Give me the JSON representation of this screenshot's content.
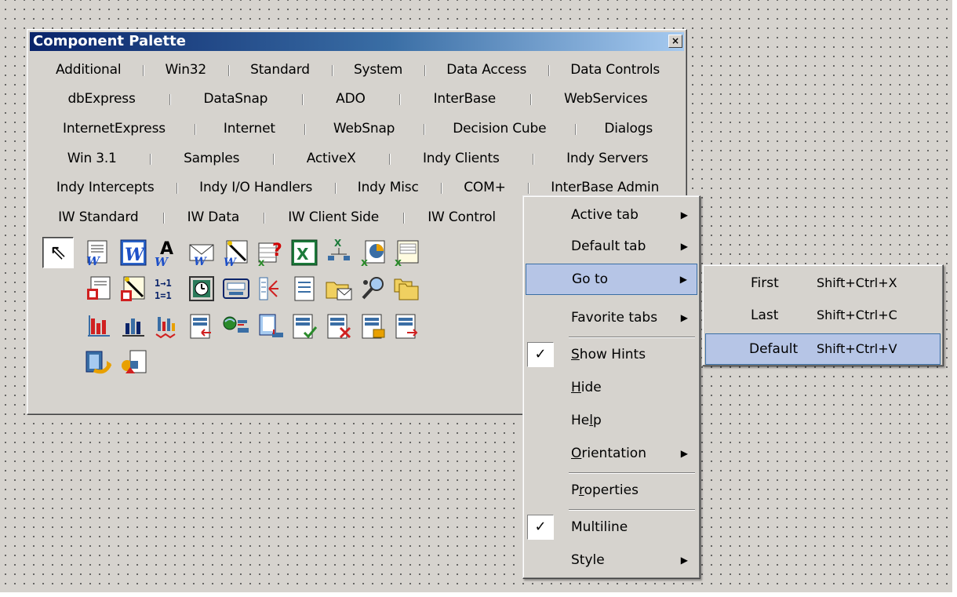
{
  "window": {
    "title": "Component Palette",
    "close_glyph": "×"
  },
  "tab_rows": [
    [
      "Additional",
      "Win32",
      "Standard",
      "System",
      "Data Access",
      "Data Controls"
    ],
    [
      "dbExpress",
      "DataSnap",
      "ADO",
      "InterBase",
      "WebServices"
    ],
    [
      "InternetExpress",
      "Internet",
      "WebSnap",
      "Decision Cube",
      "Dialogs"
    ],
    [
      "Win 3.1",
      "Samples",
      "ActiveX",
      "Indy Clients",
      "Indy Servers"
    ],
    [
      "Indy Intercepts",
      "Indy I/O Handlers",
      "Indy Misc",
      "COM+",
      "InterBase Admin"
    ],
    [
      "IW Standard",
      "IW Data",
      "IW Client Side",
      "IW Control"
    ]
  ],
  "active_tab": "Additional",
  "icons": [
    "arrow-pointer-icon",
    "word-document-icon",
    "word-application-icon",
    "word-font-icon",
    "word-mail-icon",
    "word-wizard-icon",
    "excel-query-icon",
    "excel-application-icon",
    "excel-tree-icon",
    "excel-chart-icon",
    "excel-sheet-icon",
    "report-red-icon",
    "report-wizard-icon",
    "binary-arrows-icon",
    "clock-panel-icon",
    "keyboard-icon",
    "split-arrows-icon",
    "text-page-icon",
    "mail-folder-icon",
    "search-binoculars-icon",
    "folder-stack-icon",
    "red-bar-chart-icon",
    "blue-bar-chart-icon",
    "multi-bar-chart-icon",
    "data-page-icon",
    "globe-link-icon",
    "notebook-icon",
    "page-check-icon",
    "page-delete-icon",
    "page-edit-icon",
    "page-insert-icon",
    "recycle-arrow-icon",
    "shapes-page-icon"
  ],
  "context_menu": {
    "items": [
      {
        "label": "Active tab",
        "submenu": true
      },
      {
        "label": "Default tab",
        "submenu": true
      },
      {
        "label": "Go to",
        "submenu": true,
        "highlighted": true
      },
      {
        "label": "Favorite tabs",
        "submenu": true
      },
      {
        "label": "Show Hints",
        "accel": "S",
        "checked": true
      },
      {
        "label": "Hide",
        "accel": "H"
      },
      {
        "label": "Help",
        "accel": "l"
      },
      {
        "label": "Orientation",
        "accel": "O",
        "submenu": true
      },
      {
        "label": "Properties",
        "accel": "r"
      },
      {
        "label": "Multiline",
        "checked": true
      },
      {
        "label": "Style",
        "submenu": true
      }
    ],
    "check_glyph": "✓",
    "arrow_glyph": "▶"
  },
  "goto_submenu": {
    "items": [
      {
        "label": "First",
        "shortcut": "Shift+Ctrl+X"
      },
      {
        "label": "Last",
        "shortcut": "Shift+Ctrl+C"
      },
      {
        "label": "Default",
        "shortcut": "Shift+Ctrl+V",
        "highlighted": true
      }
    ]
  },
  "colors": {
    "desktop": "#d6d3ce",
    "title_start": "#0a246a",
    "title_end": "#a6caf0",
    "menu_highlight": "#b6c5e6",
    "menu_highlight_border": "#3a6ea5"
  }
}
